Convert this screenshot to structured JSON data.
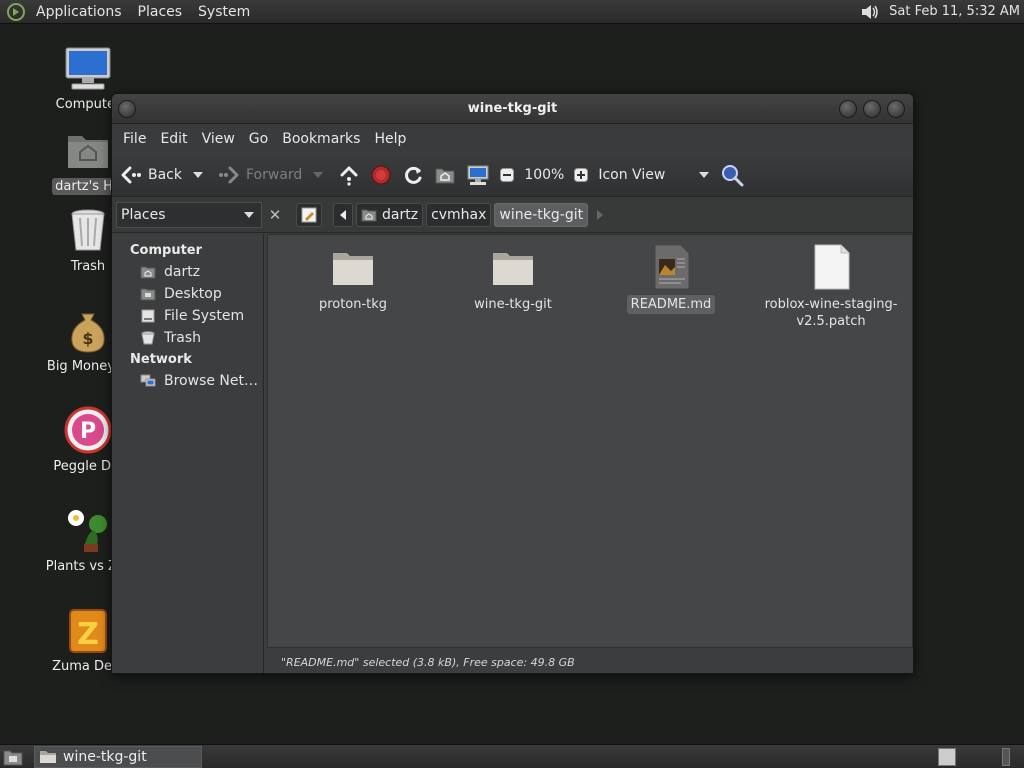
{
  "top_panel": {
    "menus": [
      "Applications",
      "Places",
      "System"
    ],
    "clock": "Sat Feb 11,  5:32 AM"
  },
  "desktop": {
    "icons": [
      {
        "label": "Computer",
        "icon": "computer-icon"
      },
      {
        "label": "dartz's Ho",
        "icon": "home-folder-icon",
        "selected": true
      },
      {
        "label": "Trash",
        "icon": "trash-icon"
      },
      {
        "label": "Big Money D",
        "icon": "money-bag-icon"
      },
      {
        "label": "Peggle Del",
        "icon": "peggle-icon"
      },
      {
        "label": "Plants vs Zor",
        "icon": "plants-icon"
      },
      {
        "label": "Zuma Delu",
        "icon": "zuma-icon"
      }
    ]
  },
  "window": {
    "title": "wine-tkg-git",
    "menu": [
      "File",
      "Edit",
      "View",
      "Go",
      "Bookmarks",
      "Help"
    ],
    "toolbar": {
      "back": "Back",
      "forward": "Forward",
      "zoom": "100%",
      "view_mode": "Icon View"
    },
    "location": {
      "places_label": "Places",
      "crumbs": [
        "dartz",
        "cvmhax",
        "wine-tkg-git"
      ]
    },
    "sidebar": {
      "computer_header": "Computer",
      "computer_items": [
        {
          "label": "dartz",
          "icon": "home-icon"
        },
        {
          "label": "Desktop",
          "icon": "desktop-icon"
        },
        {
          "label": "File System",
          "icon": "drive-icon"
        },
        {
          "label": "Trash",
          "icon": "trash-icon"
        }
      ],
      "network_header": "Network",
      "network_items": [
        {
          "label": "Browse Net…",
          "icon": "network-icon"
        }
      ]
    },
    "files": [
      {
        "name": "proton-tkg",
        "type": "folder"
      },
      {
        "name": "wine-tkg-git",
        "type": "folder"
      },
      {
        "name": "README.md",
        "type": "document",
        "selected": true
      },
      {
        "name": "roblox-wine-staging-\nv2.5.patch",
        "type": "text"
      }
    ],
    "status": "\"README.md\" selected (3.8 kB), Free space: 49.8 GB"
  },
  "bottom_panel": {
    "task_label": "wine-tkg-git"
  }
}
